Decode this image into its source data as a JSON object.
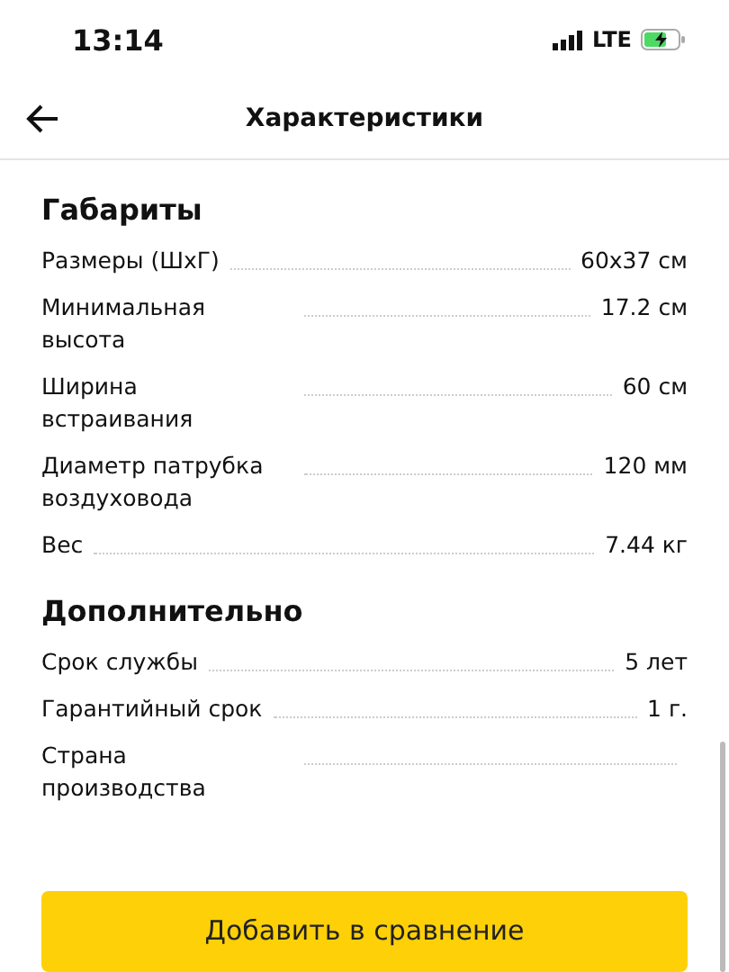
{
  "status_bar": {
    "time": "13:14",
    "network": "LTE"
  },
  "header": {
    "title": "Характеристики"
  },
  "sections": [
    {
      "title": "Габариты",
      "rows": [
        {
          "label": "Размеры (ШхГ)",
          "value": "60x37 см"
        },
        {
          "label": "Минимальная высота",
          "value": "17.2 см"
        },
        {
          "label": "Ширина встраивания",
          "value": "60 см"
        },
        {
          "label": "Диаметр патрубка воздуховода",
          "value": "120 мм"
        },
        {
          "label": "Вес",
          "value": "7.44 кг"
        }
      ]
    },
    {
      "title": "Дополнительно",
      "rows": [
        {
          "label": "Срок службы",
          "value": "5 лет"
        },
        {
          "label": "Гарантийный срок",
          "value": "1 г."
        },
        {
          "label": "Страна производства"
        }
      ]
    }
  ],
  "button": {
    "label": "Добавить в сравнение"
  }
}
